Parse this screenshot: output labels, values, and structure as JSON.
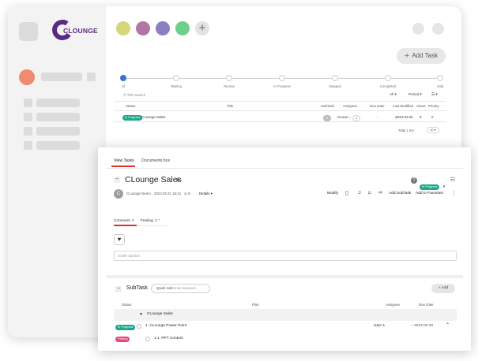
{
  "app": {
    "logo_text": "CLOUNGE",
    "brand_color": "#5a2a82",
    "accent_color": "#d7342f"
  },
  "project_circles": [
    {
      "color": "#d6d67a"
    },
    {
      "color": "#b276a6"
    },
    {
      "color": "#8c7dc5"
    },
    {
      "color": "#6dd08a"
    }
  ],
  "header": {
    "plus_glyph": "+",
    "add_task": "Add Task"
  },
  "steps": [
    "All",
    "Waiting",
    "Review",
    "In Progress",
    "Stopped",
    "Completed",
    "Hold"
  ],
  "filters": {
    "search": "Title search",
    "scope": "All",
    "period": "Period"
  },
  "task_table": {
    "columns": [
      "Status",
      "Title",
      "SubTask",
      "Assignee",
      "Due Date",
      "Last Modified",
      "Views",
      "Priority"
    ],
    "rows": [
      {
        "status": "In Progress",
        "title": "CLounge Sales",
        "subtask": "4",
        "assignee": "CLoun...",
        "assignee_count": "1",
        "due_date": "-",
        "last_modified": "2024.03.21",
        "views": "5",
        "priority": "★"
      }
    ],
    "total_label": "Total",
    "total_value": "1",
    "per_page": "10"
  },
  "detail": {
    "tabs": [
      "View Tasks",
      "Documents box"
    ],
    "title": "CLounge Sales",
    "status": "In Progress",
    "author": "CLounge Demo",
    "date": "2024.03.21 16:41",
    "views": "8",
    "details_label": "Details",
    "actions": {
      "modify": "Modify",
      "add_subtask": "Add SubTask",
      "add_favorites": "Add to Favorites"
    },
    "comment_tab": "Comment",
    "comment_count": "0",
    "feeling_tab": "Feeling",
    "feeling_count": "0",
    "opinion_placeholder": "Enter opinion"
  },
  "subtask": {
    "title": "SubTask",
    "quick_add_label": "Quick Add",
    "quick_add_placeholder": "Enter keyword.",
    "add_button": "Add",
    "columns": [
      "Status",
      "Plan",
      "Assignee",
      "Due Date"
    ],
    "group": "CLounge Sales",
    "rows": [
      {
        "status": "In Progress",
        "plan": "1. CLounge Power Point",
        "assignee": "User 1",
        "due_date": "~ 2024.03.30"
      },
      {
        "status": "Feeling",
        "plan": "1.1. PPT Content",
        "assignee": "",
        "due_date": ""
      }
    ]
  }
}
